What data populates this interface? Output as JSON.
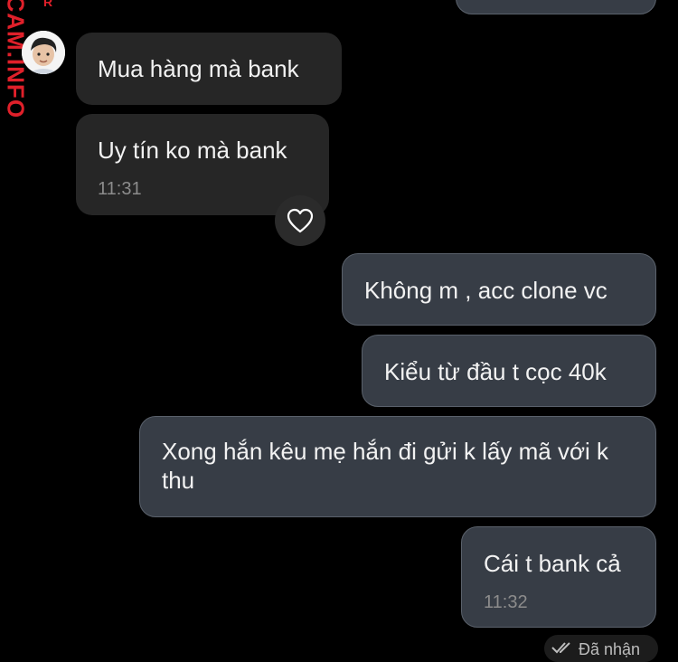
{
  "watermark": {
    "main": "CAM.INFO",
    "small": "R"
  },
  "avatar": {
    "icon": "user-avatar"
  },
  "messages": [
    {
      "side": "out",
      "text": ""
    },
    {
      "side": "in",
      "text": "Mua hàng mà bank"
    },
    {
      "side": "in",
      "text": "Uy tín ko mà bank",
      "time": "11:31",
      "reaction": "heart-icon"
    },
    {
      "side": "out",
      "text": "Không m , acc clone vc"
    },
    {
      "side": "out",
      "text": "Kiểu từ đầu t cọc 40k"
    },
    {
      "side": "out",
      "text": "Xong hắn kêu mẹ hắn đi gửi k lấy mã với k thu"
    },
    {
      "side": "out",
      "text": "Cái t bank cả",
      "time": "11:32"
    }
  ],
  "status": {
    "label": "Đã nhận",
    "icon": "double-check-icon"
  },
  "colors": {
    "incoming": "#262626",
    "outgoing": "#373d46",
    "watermark": "#e0202a"
  }
}
